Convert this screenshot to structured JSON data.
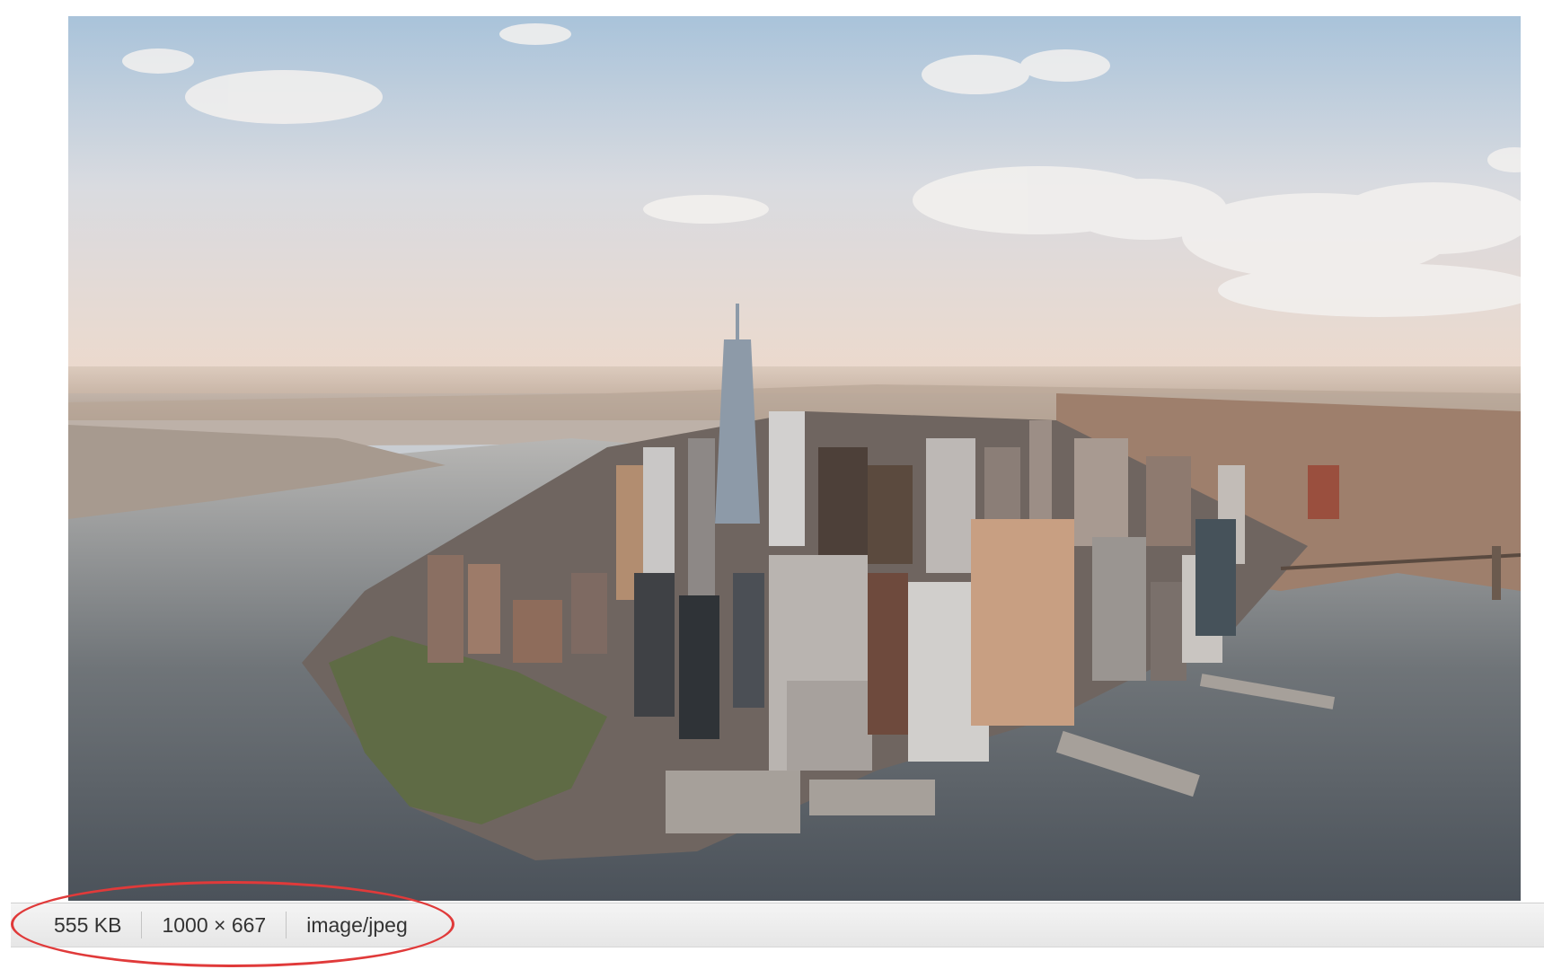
{
  "preview": {
    "content": "aerial-photo"
  },
  "statusbar": {
    "file_size": "555 KB",
    "dimensions": "1000 × 667",
    "mime_type": "image/jpeg"
  },
  "annotation": {
    "color": "#e03a3a",
    "shape": "ellipse"
  }
}
